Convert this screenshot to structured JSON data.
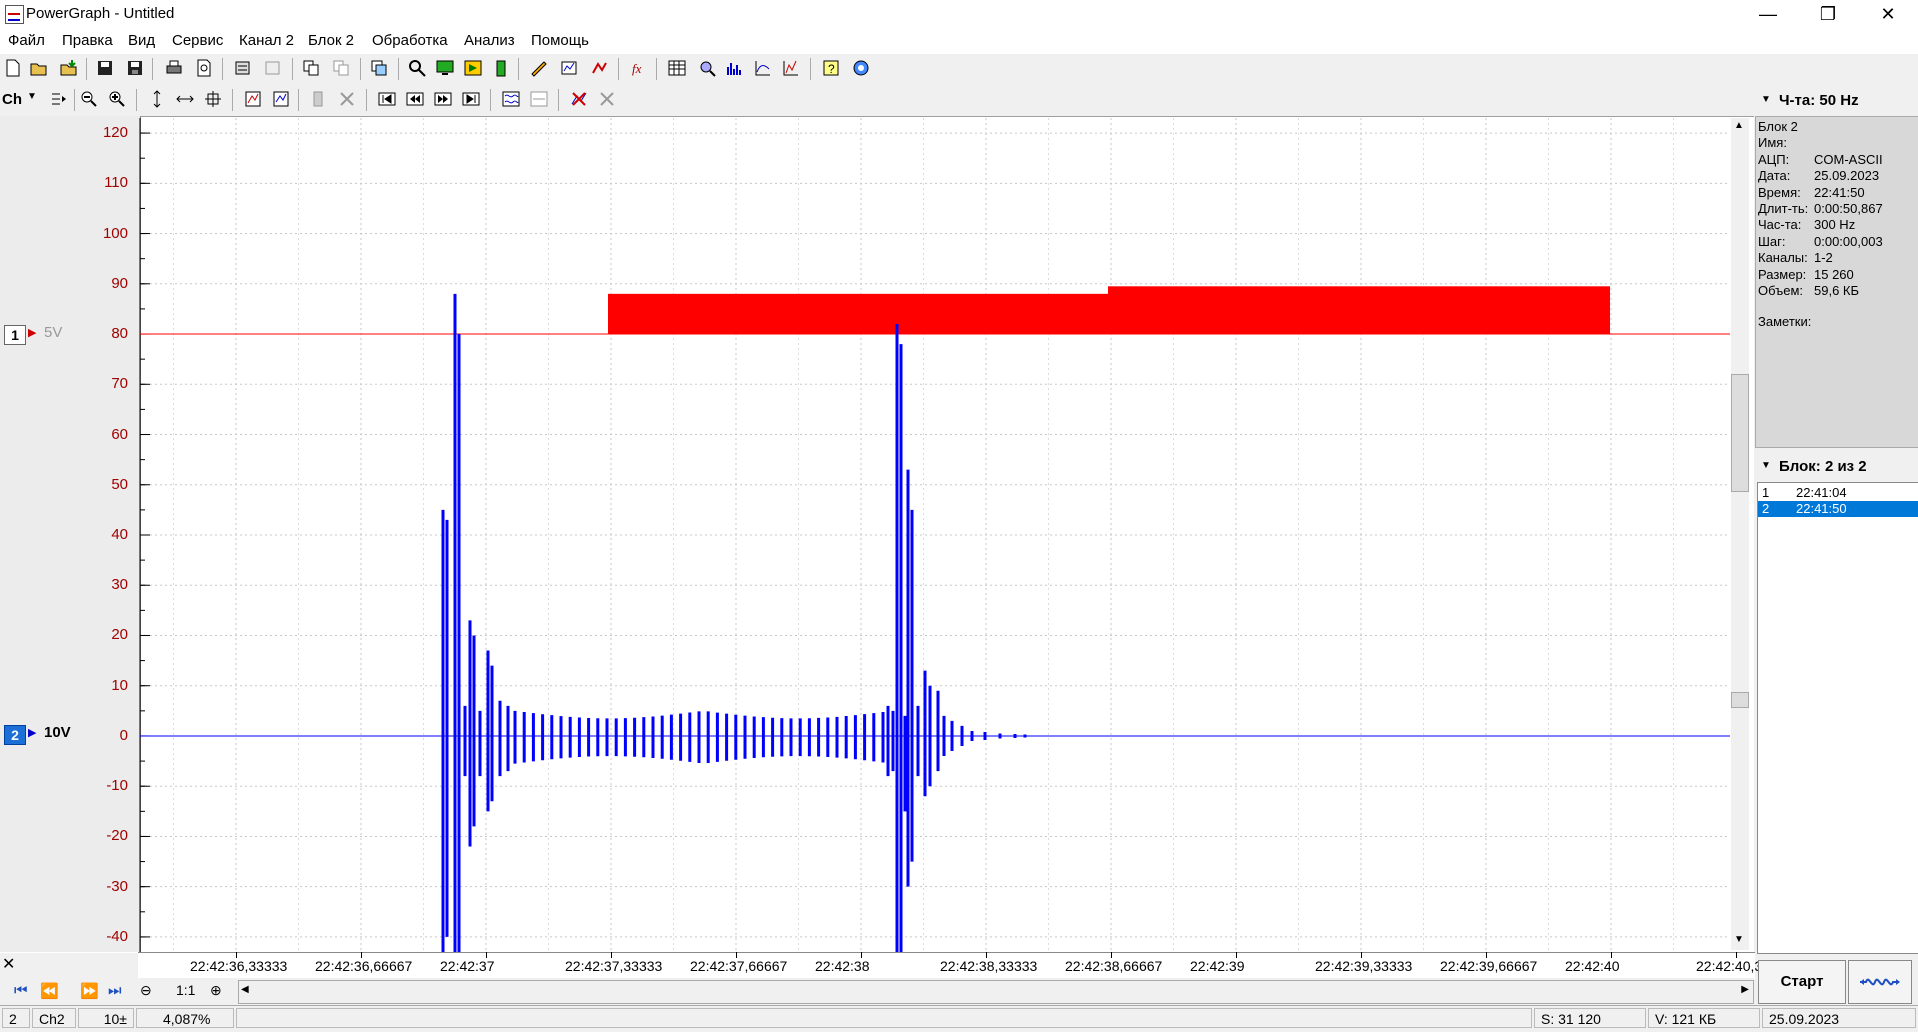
{
  "window": {
    "title": "PowerGraph - Untitled",
    "minimize": "—",
    "restore": "❐",
    "close": "✕"
  },
  "menu": [
    "Файл",
    "Правка",
    "Вид",
    "Сервис",
    "Канал 2",
    "Блок 2",
    "Обработка",
    "Анализ",
    "Помощь"
  ],
  "toolbar2": {
    "channel_label": "Ch"
  },
  "channels": [
    {
      "number": "1",
      "scale": "5V",
      "color": "#ff0000"
    },
    {
      "number": "2",
      "scale": "10V",
      "color": "#0000ff"
    }
  ],
  "panel": {
    "freq_header": "Ч-та: 50 Hz",
    "info": [
      {
        "key": "Блок 2",
        "value": ""
      },
      {
        "key": "Имя:",
        "value": ""
      },
      {
        "key": "АЦП:",
        "value": "COM-ASCII"
      },
      {
        "key": "Дата:",
        "value": "25.09.2023"
      },
      {
        "key": "Время:",
        "value": "22:41:50"
      },
      {
        "key": "Длит-ть:",
        "value": "0:00:50,867"
      },
      {
        "key": "Час-та:",
        "value": "300 Hz"
      },
      {
        "key": "Шаг:",
        "value": "0:00:00,003"
      },
      {
        "key": "Каналы:",
        "value": "1-2"
      },
      {
        "key": "Размер:",
        "value": "15 260"
      },
      {
        "key": "Объем:",
        "value": "59,6 КБ"
      }
    ],
    "notes_label": "Заметки:",
    "block_header": "Блок: 2 из 2",
    "blocks": [
      {
        "num": "1",
        "time": "22:41:04",
        "selected": false
      },
      {
        "num": "2",
        "time": "22:41:50",
        "selected": true
      }
    ],
    "start_button": "Старт"
  },
  "chart_data": {
    "type": "line",
    "y_ticks": [
      "120",
      "110",
      "100",
      "90",
      "80",
      "70",
      "60",
      "50",
      "40",
      "30",
      "20",
      "10",
      "0",
      "-10",
      "-20",
      "-30",
      "-40"
    ],
    "ylim": [
      -43,
      123
    ],
    "x_ticks": [
      "22:42:36,33333",
      "22:42:36,66667",
      "22:42:37",
      "22:42:37,33333",
      "22:42:37,66667",
      "22:42:38",
      "22:42:38,33333",
      "22:42:38,66667",
      "22:42:39",
      "22:42:39,33333",
      "22:42:39,66667",
      "22:42:40",
      "22:42:40,3"
    ],
    "grid": true,
    "series": [
      {
        "color": "#ff0000",
        "description_points": [
          {
            "t": 0.0,
            "v": 80
          },
          {
            "t": 1.3,
            "v": 80
          },
          {
            "t": 1.3,
            "v": 88
          },
          {
            "t": 2.62,
            "v": 88
          },
          {
            "t": 2.62,
            "v": 89
          },
          {
            "t": 3.95,
            "v": 89
          },
          {
            "t": 3.95,
            "v": 80
          },
          {
            "t": 5.0,
            "v": 80
          }
        ]
      },
      {
        "color": "#0000ff",
        "bursts": [
          {
            "t": 0.8,
            "amp_pos": 45,
            "amp_neg": -43
          },
          {
            "t": 0.82,
            "amp_pos": 88,
            "amp_neg": -43
          },
          {
            "t": 0.86,
            "amp_pos": 23,
            "amp_neg": -22
          },
          {
            "t": 0.9,
            "amp_pos": 18,
            "amp_neg": -16
          },
          {
            "t": 1.97,
            "amp_pos": 82,
            "amp_neg": -43
          },
          {
            "t": 2.01,
            "amp_pos": 53,
            "amp_neg": -32
          },
          {
            "t": 2.05,
            "amp_pos": 13,
            "amp_neg": -10
          }
        ],
        "steady_amp": 4
      }
    ]
  },
  "navbar": {
    "zoom_ratio": "1:1"
  },
  "status": {
    "block": "2",
    "channel": "Ch2",
    "range": "10±",
    "percent": "4,087%",
    "samples": "S: 31 120",
    "volume": "V: 121 КБ",
    "date": "25.09.2023"
  }
}
